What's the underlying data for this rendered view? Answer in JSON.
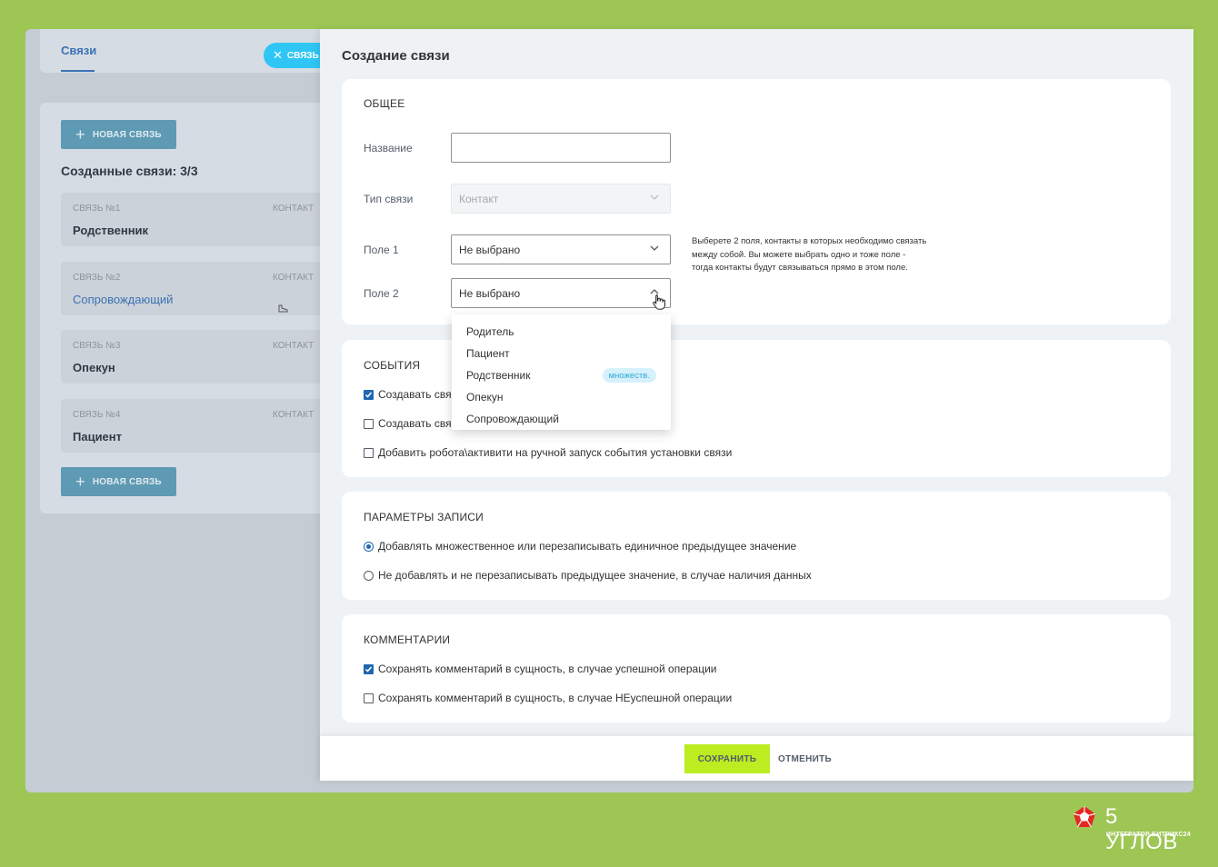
{
  "background_app": {
    "tab_label": "Связи",
    "close_pill_label": "СВЯЗЬ",
    "new_link_label": "НОВАЯ СВЯЗЬ",
    "created_title": "Созданные связи: 3/3",
    "links": [
      {
        "num": "СВЯЗЬ №1",
        "kind": "КОНТАКТ",
        "name": "Родственник"
      },
      {
        "num": "СВЯЗЬ №2",
        "kind": "КОНТАКТ",
        "name": "Сопровождающий"
      },
      {
        "num": "СВЯЗЬ №3",
        "kind": "КОНТАКТ",
        "name": "Опекун"
      },
      {
        "num": "СВЯЗЬ №4",
        "kind": "КОНТАКТ",
        "name": "Пациент"
      }
    ]
  },
  "slider": {
    "title": "Создание связи",
    "general": {
      "section_title": "ОБЩЕЕ",
      "name_label": "Название",
      "name_value": "",
      "type_label": "Тип связи",
      "type_value": "Контакт",
      "field1_label": "Поле 1",
      "field1_value": "Не выбрано",
      "field2_label": "Поле 2",
      "field2_value": "Не выбрано",
      "hint": "Выберете 2 поля, контакты в которых необходимо связать между собой. Вы можете выбрать одно и тоже поле - тогда контакты будут связываться прямо в этом поле."
    },
    "dropdown": {
      "options": [
        "Родитель",
        "Пациент",
        "Родственник",
        "Опекун",
        "Сопровождающий"
      ],
      "badge": "множеств."
    },
    "events": {
      "section_title": "СОБЫТИЯ",
      "items": [
        {
          "label": "Создавать связ",
          "checked": true
        },
        {
          "label": "Создавать свя",
          "checked": false
        },
        {
          "label": "Добавить робота\\активити на ручной запуск события установки связи",
          "checked": false
        }
      ]
    },
    "record_params": {
      "section_title": "ПАРАМЕТРЫ ЗАПИСИ",
      "options": [
        {
          "label": "Добавлять множественное или перезаписывать единичное предыдущее значение",
          "selected": true
        },
        {
          "label": "Не добавлять и не перезаписывать предыдущее значение, в случае наличия данных",
          "selected": false
        }
      ]
    },
    "comments": {
      "section_title": "КОММЕНТАРИИ",
      "items": [
        {
          "label": "Сохранять комментарий в сущность, в случае успешной операции",
          "checked": true
        },
        {
          "label": "Сохранять комментарий в сущность, в случае НЕуспешной операции",
          "checked": false
        }
      ]
    },
    "footer": {
      "save_label": "СОХРАНИТЬ",
      "cancel_label": "ОТМЕНИТЬ"
    }
  },
  "brand": {
    "name": "5 УГЛОВ",
    "subtitle": "ИНТЕГРАТОР БИТРИКС24"
  },
  "colors": {
    "page_bg": "#9dc655",
    "accent_blue": "#2066b0",
    "pill_blue": "#2fc6f6",
    "save_green": "#bbed21"
  }
}
